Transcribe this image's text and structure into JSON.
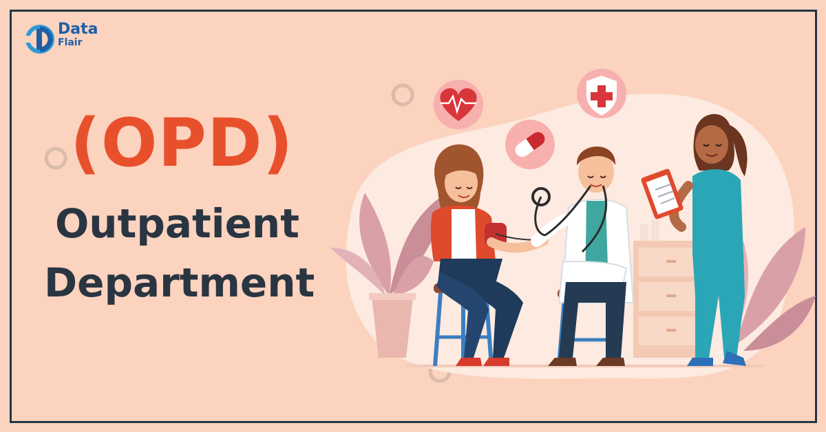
{
  "logo": {
    "word_1": "Data",
    "word_2": "Flair"
  },
  "headline": {
    "abbrev": "(OPD)",
    "line_1": "Outpatient",
    "line_2": "Department"
  },
  "colors": {
    "background": "#fbd3bf",
    "frame": "#243545",
    "accent": "#e8502c",
    "text_dark": "#2a3542",
    "brand_blue": "#1f5fa8"
  },
  "illustration": {
    "icons": [
      "heart-pulse-icon",
      "pill-capsule-icon",
      "medical-shield-icon"
    ],
    "figures": [
      "patient",
      "doctor-with-stethoscope",
      "nurse-with-clipboard"
    ]
  }
}
